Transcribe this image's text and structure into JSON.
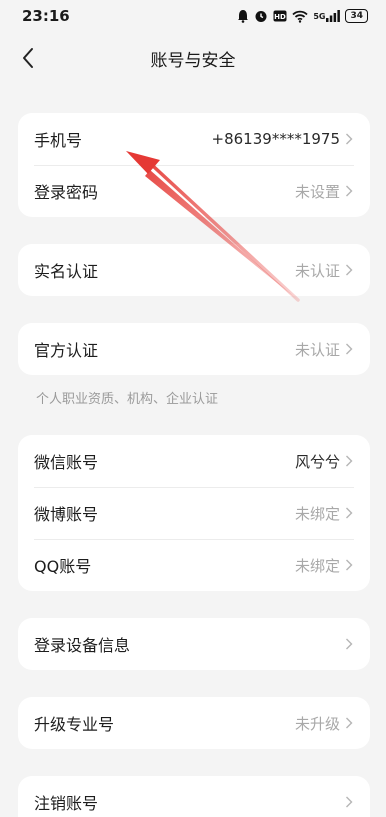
{
  "status_bar": {
    "time": "23:16",
    "icons": [
      "alarm-icon",
      "clock-icon",
      "hd-icon",
      "wifi-icon",
      "signal-icon"
    ],
    "signal_text": "5G",
    "battery": "34"
  },
  "header": {
    "title": "账号与安全",
    "back_icon": "chevron-left-icon"
  },
  "groups": [
    {
      "items": [
        {
          "label": "手机号",
          "value": "+86139****1975",
          "value_dark": true
        },
        {
          "label": "登录密码",
          "value": "未设置",
          "value_dark": false
        }
      ]
    },
    {
      "items": [
        {
          "label": "实名认证",
          "value": "未认证",
          "value_dark": false
        }
      ]
    },
    {
      "items": [
        {
          "label": "官方认证",
          "value": "未认证",
          "value_dark": false
        }
      ],
      "note": "个人职业资质、机构、企业认证"
    },
    {
      "items": [
        {
          "label": "微信账号",
          "value": "风兮兮",
          "value_dark": true
        },
        {
          "label": "微博账号",
          "value": "未绑定",
          "value_dark": false
        },
        {
          "label": "QQ账号",
          "value": "未绑定",
          "value_dark": false
        }
      ]
    },
    {
      "items": [
        {
          "label": "登录设备信息",
          "value": "",
          "value_dark": false
        }
      ]
    },
    {
      "items": [
        {
          "label": "升级专业号",
          "value": "未升级",
          "value_dark": false
        }
      ]
    },
    {
      "items": [
        {
          "label": "注销账号",
          "value": "",
          "value_dark": false
        }
      ]
    }
  ],
  "colors": {
    "background": "#f4f4f4",
    "card": "#ffffff",
    "muted_text": "#a8a8a8",
    "annotation_arrow": "#e53935"
  }
}
